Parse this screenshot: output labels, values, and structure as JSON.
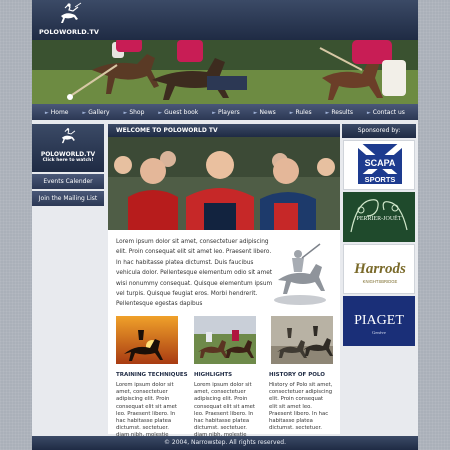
{
  "logo": {
    "text": "POLOWORLD.TV"
  },
  "nav": [
    {
      "label": "Home"
    },
    {
      "label": "Gallery"
    },
    {
      "label": "Shop"
    },
    {
      "label": "Guest book"
    },
    {
      "label": "Players"
    },
    {
      "label": "News"
    },
    {
      "label": "Rules"
    },
    {
      "label": "Results"
    },
    {
      "label": "Contact us"
    }
  ],
  "left": {
    "promo_title": "POLOWORLD.TV",
    "promo_sub": "Click here to watch!",
    "events": "Events Calender",
    "mailing": "Join the Mailing List"
  },
  "main": {
    "welcome": "WELCOME TO POLOWORLD TV",
    "intro": "Lorem ipsum dolor sit amet, consectetuer adipiscing elit. Proin consequat elit sit amet leo. Praesent libero. In hac habitasse platea dictumst. Duis faucibus vehicula dolor. Pellentesque elementum odio sit amet wisi nonummy consequat. Quisque elementum ipsum vel turpis. Quisque feugiat eros. Morbi hendrerit. Pellentesque egestas dapibus",
    "columns": [
      {
        "title": "TRAINING TECHNIQUES",
        "text": "Lorem ipsum dolor sit amet, consectetuer adipiscing elit. Proin consequat elit sit amet leo. Praesent libero. In hac habitasse platea dictumst. sectetuer. diam nibh, molestie"
      },
      {
        "title": "HIGHLIGHTS",
        "text": "Lorem ipsum dolor sit amet, consectetuer adipiscing elit. Proin consequat elit sit amet leo. Praesent libero. In hac habitasse platea dictumst. sectetuer. diam nibh, molestie"
      },
      {
        "title": "HISTORY OF POLO",
        "text": "History of Polo sit amet, consectetuer adipiscing elit. Proin consequat elit sit amet leo. Praesent libero. In hac habitasse platea dictumst. sectetuer."
      }
    ]
  },
  "sponsors": {
    "heading": "Sponsored by:",
    "scapa": {
      "line1": "SCAPA",
      "line2": "SPORTS"
    },
    "perrier": {
      "line1": "PERRIER-JOUËT"
    },
    "harrods": {
      "line1": "Harrods",
      "line2": "KNIGHTSBRIDGE"
    },
    "piaget": {
      "line1": "PIAGET",
      "line2": "Genève"
    }
  },
  "footer": {
    "text": "© 2004, Narrowstep. All rights reserved."
  }
}
